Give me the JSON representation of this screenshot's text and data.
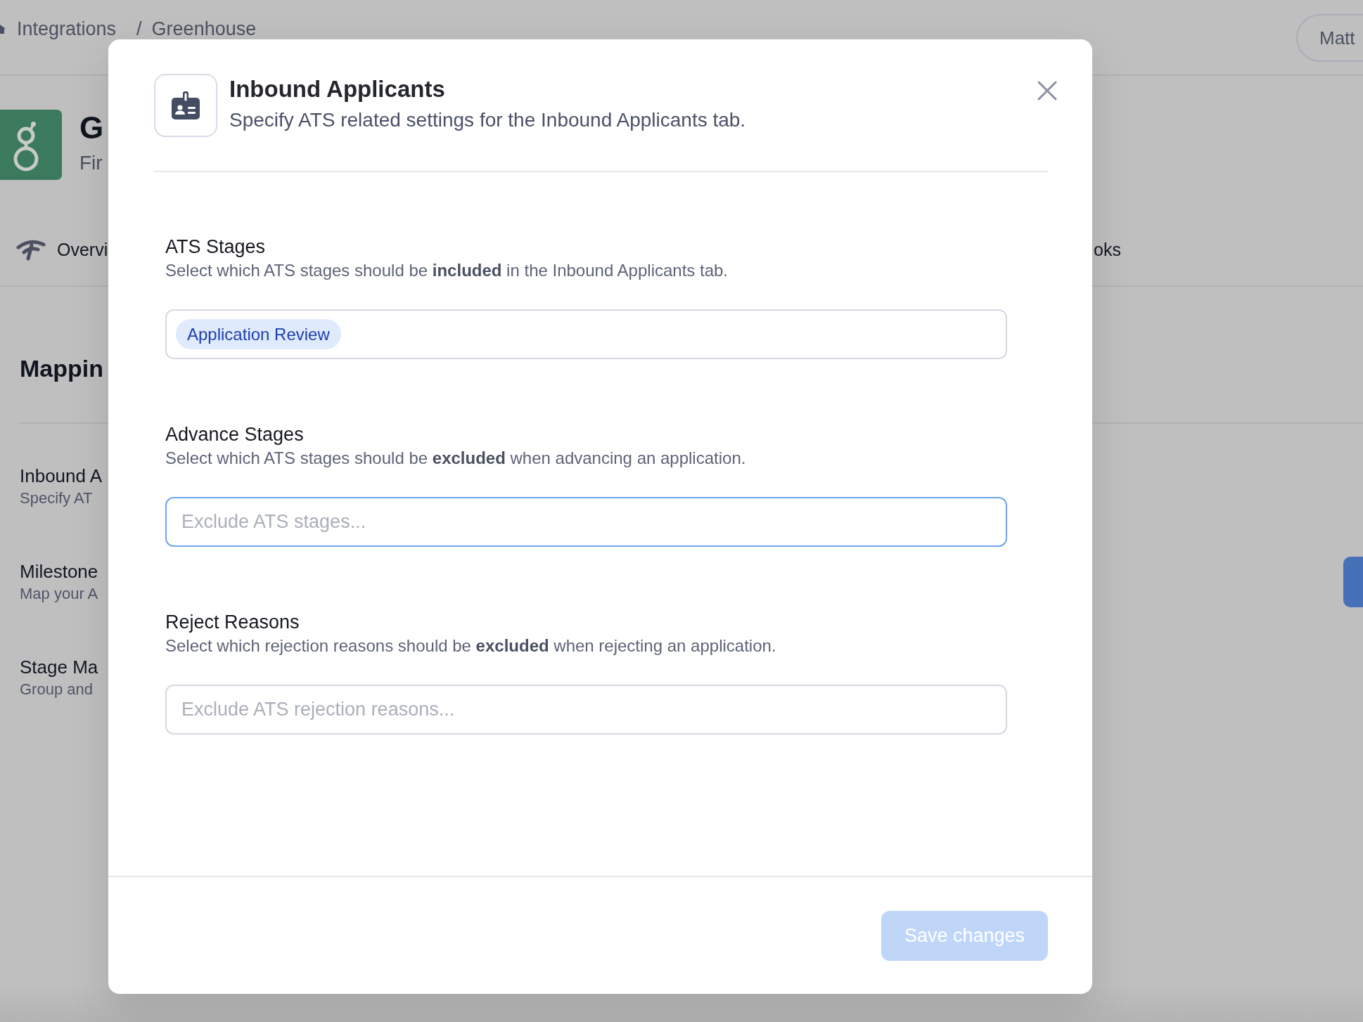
{
  "page": {
    "breadcrumb": [
      {
        "label": "Integrations"
      },
      {
        "label": "Greenhouse"
      }
    ],
    "breadcrumb_separator": "/",
    "user_menu": {
      "label": "Matt"
    },
    "integration": {
      "name": "G",
      "subtitle": "Fir"
    },
    "tabs": [
      {
        "label": "Overvi",
        "kind": "icon"
      },
      {
        "label": "oks",
        "kind": "text"
      }
    ],
    "section_title": "Mappin",
    "settings_list": [
      {
        "title": "Inbound A",
        "description": "Specify AT",
        "action_button": false
      },
      {
        "title": "Milestone",
        "description": "Map your A",
        "action_button": true
      },
      {
        "title": "Stage Ma",
        "description": "Group and",
        "action_button": false
      }
    ]
  },
  "modal": {
    "title": "Inbound Applicants",
    "subtitle": "Specify ATS related settings for the Inbound Applicants tab.",
    "fields": [
      {
        "label": "ATS Stages",
        "description": "Select which ATS stages should be **included** in the Inbound Applicants tab.",
        "tags": [
          {
            "label": "Application Review"
          }
        ],
        "focused": false
      },
      {
        "label": "Advance Stages",
        "description": "Select which ATS stages should be **excluded** when advancing an application.",
        "placeholder": "Exclude ATS stages...",
        "focused": true
      },
      {
        "label": "Reject Reasons",
        "description": "Select which rejection reasons should be **excluded** when rejecting an application.",
        "placeholder": "Exclude ATS rejection reasons...",
        "focused": false
      }
    ],
    "save_button": {
      "label": "Save changes",
      "disabled": true
    }
  }
}
